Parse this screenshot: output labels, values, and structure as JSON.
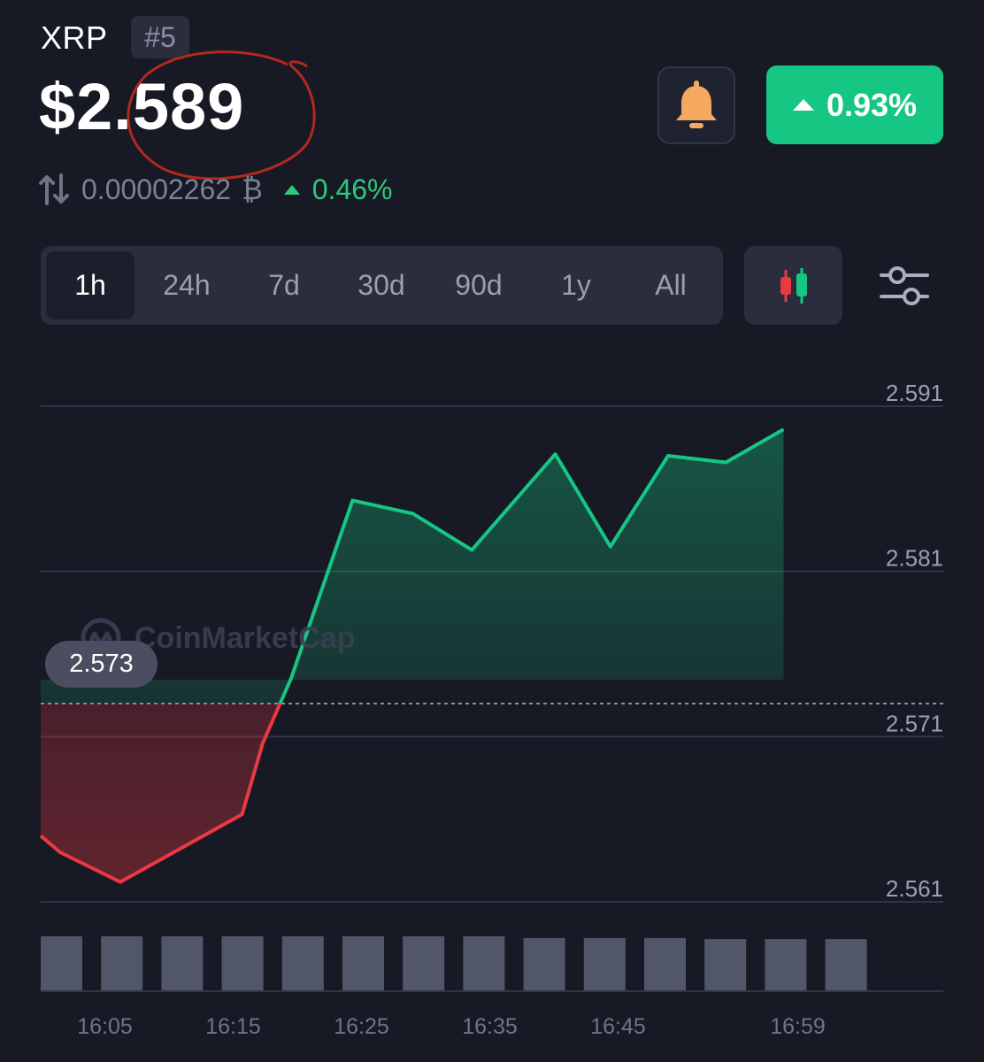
{
  "coin": {
    "symbol": "XRP",
    "rank": "#5",
    "price": "$2.589",
    "btc_value": "0.00002262",
    "btc_symbol": "₿",
    "btc_change": "0.46%",
    "change_24h": "0.93%"
  },
  "range_tabs": [
    "1h",
    "24h",
    "7d",
    "30d",
    "90d",
    "1y",
    "All"
  ],
  "active_tab": "1h",
  "watermark": "CoinMarketCap",
  "reference_price_label": "2.573",
  "colors": {
    "background": "#171924",
    "up": "#16c784",
    "down": "#ea3943",
    "bell": "#f5a860"
  },
  "chart_data": {
    "type": "area",
    "ylim": [
      2.561,
      2.591
    ],
    "y_ticks": [
      "2.591",
      "2.581",
      "2.571",
      "2.561"
    ],
    "reference_value": 2.573,
    "x_ticks": [
      "16:05",
      "16:15",
      "16:25",
      "16:35",
      "16:45",
      "16:59"
    ],
    "x_tick_minutes": [
      5,
      15,
      25,
      35,
      45,
      59
    ],
    "x_minutes": [
      0,
      1.5,
      6.2,
      15.7,
      17.3,
      19.5,
      24.3,
      29,
      33.6,
      40.1,
      44.4,
      48.9,
      53.4,
      57.9
    ],
    "values": [
      2.565,
      2.564,
      2.5622,
      2.5663,
      2.5706,
      2.5745,
      2.5853,
      2.5845,
      2.5823,
      2.5881,
      2.5825,
      2.588,
      2.5876,
      2.5896
    ],
    "volume": [
      1.0,
      1.0,
      1.0,
      1.0,
      1.0,
      1.0,
      1.0,
      1.0,
      0.97,
      0.97,
      0.97,
      0.95,
      0.95,
      0.95
    ]
  }
}
